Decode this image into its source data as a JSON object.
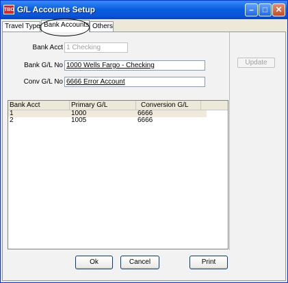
{
  "window": {
    "title": "G/L Accounts Setup",
    "app_icon_text": "TBO",
    "min_glyph": "–",
    "max_glyph": "□",
    "close_glyph": "✕"
  },
  "tabs": [
    {
      "label": "Travel Types"
    },
    {
      "label": "Bank Accounts"
    },
    {
      "label": "Others"
    }
  ],
  "form": {
    "bank_acct_label": "Bank Acct",
    "bank_acct_value": "1 Checking",
    "bank_gl_label": "Bank G/L No",
    "bank_gl_value": "1000 Wells Fargo - Checking",
    "conv_gl_label": "Conv G/L No",
    "conv_gl_value": "6666 Error Account",
    "update_label": "Update"
  },
  "grid": {
    "headers": [
      "Bank Acct",
      "Primary G/L",
      "Conversion G/L"
    ],
    "rows": [
      [
        "1",
        "1000",
        "6666"
      ],
      [
        "2",
        "1005",
        "6666"
      ]
    ]
  },
  "buttons": {
    "ok": "Ok",
    "cancel": "Cancel",
    "print": "Print"
  }
}
